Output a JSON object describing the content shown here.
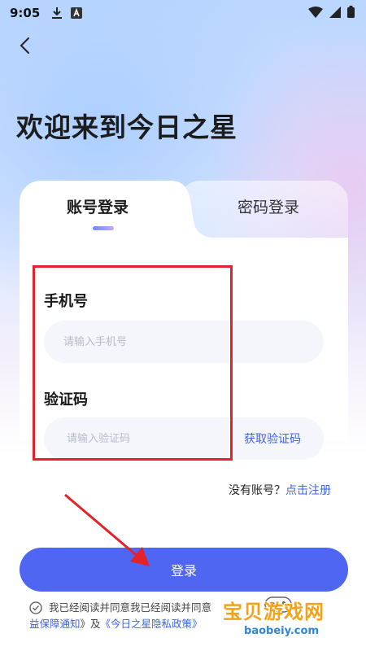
{
  "status_bar": {
    "time": "9:05",
    "icons": [
      "download-icon",
      "keyboard-a-icon",
      "wifi-icon",
      "signal-icon",
      "battery-icon"
    ]
  },
  "header": {
    "back_icon": "chevron-left-icon",
    "title": "欢迎来到今日之星"
  },
  "tabs": [
    {
      "label": "账号登录",
      "active": true
    },
    {
      "label": "密码登录",
      "active": false
    }
  ],
  "form": {
    "phone_label": "手机号",
    "phone_placeholder": "请输入手机号",
    "phone_value": "",
    "code_label": "验证码",
    "code_placeholder": "请输入验证码",
    "code_value": "",
    "get_code_label": "获取验证码"
  },
  "register": {
    "prompt": "没有账号？",
    "link": "点击注册"
  },
  "login_button": "登录",
  "agreement": {
    "text": "我已经阅读并同意我已经阅读并同意",
    "link1_tail": "益保障通知",
    "and": "》及",
    "link2": "《今日之星隐私政策》"
  },
  "watermark": {
    "main": "宝贝游戏网",
    "url": "baobeiy.com"
  },
  "colors": {
    "accent": "#4f66f2",
    "link": "#3e63e6",
    "highlight": "#e3222a"
  }
}
